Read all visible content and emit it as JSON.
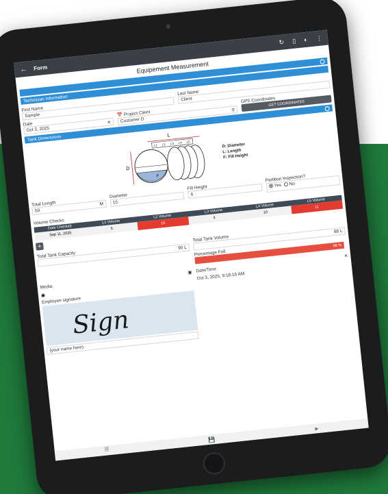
{
  "side_fragments": [
    "s",
    "ual",
    "nt"
  ],
  "appbar": {
    "back_icon": "arrow-left-icon",
    "title": "Form",
    "icons": [
      "refresh-icon",
      "bookmark-icon",
      "contrast-icon",
      "more-icon"
    ]
  },
  "form": {
    "title": "Equipement Measurement",
    "sections": {
      "technician": "Technician Information",
      "tank": "Tank Dimensions"
    },
    "first_name": {
      "label": "First Name",
      "value": "Sample"
    },
    "last_name": {
      "label": "Last Name",
      "value": "Client"
    },
    "date": {
      "label": "Date",
      "value": "Oct 3, 2025"
    },
    "project_client": {
      "label": "Project Client",
      "value": "Customer D"
    },
    "gps": {
      "label": "GPS Coordinates",
      "button": "GET COORDINATES"
    },
    "diagram": {
      "top_label": "L",
      "side_label": "D",
      "fill_label": "F",
      "segments": [
        "L1",
        "L2",
        "L3",
        "L4",
        "L5"
      ],
      "legend": [
        "D: Diameter",
        "L: Length",
        "F: Fill Height"
      ]
    },
    "total_length": {
      "label": "Total Length",
      "value": "50",
      "unit": "M"
    },
    "diameter": {
      "label": "Diameter",
      "value": "15"
    },
    "fill_height": {
      "label": "Fill Height",
      "value": "6"
    },
    "partition": {
      "label": "Partition Inspection?",
      "yes": "Yes",
      "no": "No",
      "selected": "Yes"
    },
    "volume_checks": {
      "label": "Volume Checks",
      "columns": [
        "Date Checked",
        "L1 Volume",
        "L2 Volume",
        "L3 Volume",
        "L4 Volume",
        "L5 Volume"
      ],
      "row": [
        "Sep 11, 2025",
        "5",
        "16",
        "4",
        "10",
        "11"
      ]
    },
    "add_button": "+",
    "total_tank_volume": {
      "label": "Total Tank Volume",
      "value": "88",
      "unit": "L"
    },
    "total_tank_capacity": {
      "label": "Total Tank Capacity",
      "value": "90",
      "unit": "L"
    },
    "percentage_full": {
      "label": "Percentage Full",
      "value": "98 %",
      "fraction": 0.98
    },
    "media": {
      "label": "Media"
    },
    "datetime": {
      "label": "Date/Time",
      "value": "Oct 3, 2025, 9:18:16 AM"
    },
    "signature": {
      "label": "Employee signature",
      "text": "Sign",
      "name_placeholder": "(your name here)"
    }
  },
  "colors": {
    "green_bg": "#1f7a3c",
    "section_blue": "#2f8fd6",
    "red_cell": "#e53a2f",
    "percent_bar": "#e64f3f",
    "appbar": "#3c3f45"
  }
}
